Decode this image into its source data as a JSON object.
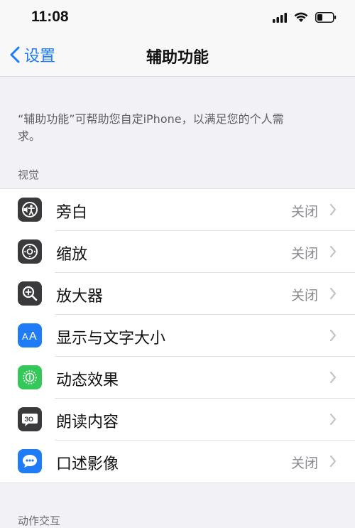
{
  "status_bar": {
    "time": "11:08"
  },
  "nav": {
    "back_label": "设置",
    "title": "辅助功能"
  },
  "description": "“辅助功能”可帮助您自定iPhone，以满足您的个人需求。",
  "sections": [
    {
      "header": "视觉",
      "items": [
        {
          "label": "旁白",
          "value": "关闭",
          "icon": "voiceover-icon",
          "icon_color": "#3a3a3c"
        },
        {
          "label": "缩放",
          "value": "关闭",
          "icon": "zoom-icon",
          "icon_color": "#3a3a3c"
        },
        {
          "label": "放大器",
          "value": "关闭",
          "icon": "magnifier-icon",
          "icon_color": "#3a3a3c"
        },
        {
          "label": "显示与文字大小",
          "value": "",
          "icon": "text-size-icon",
          "icon_color": "#1f7bf6"
        },
        {
          "label": "动态效果",
          "value": "",
          "icon": "motion-icon",
          "icon_color": "#34c759"
        },
        {
          "label": "朗读内容",
          "value": "",
          "icon": "spoken-content-icon",
          "icon_color": "#3a3a3c"
        },
        {
          "label": "口述影像",
          "value": "关闭",
          "icon": "audio-description-icon",
          "icon_color": "#1f7bf6"
        }
      ]
    },
    {
      "header": "动作交互"
    }
  ]
}
